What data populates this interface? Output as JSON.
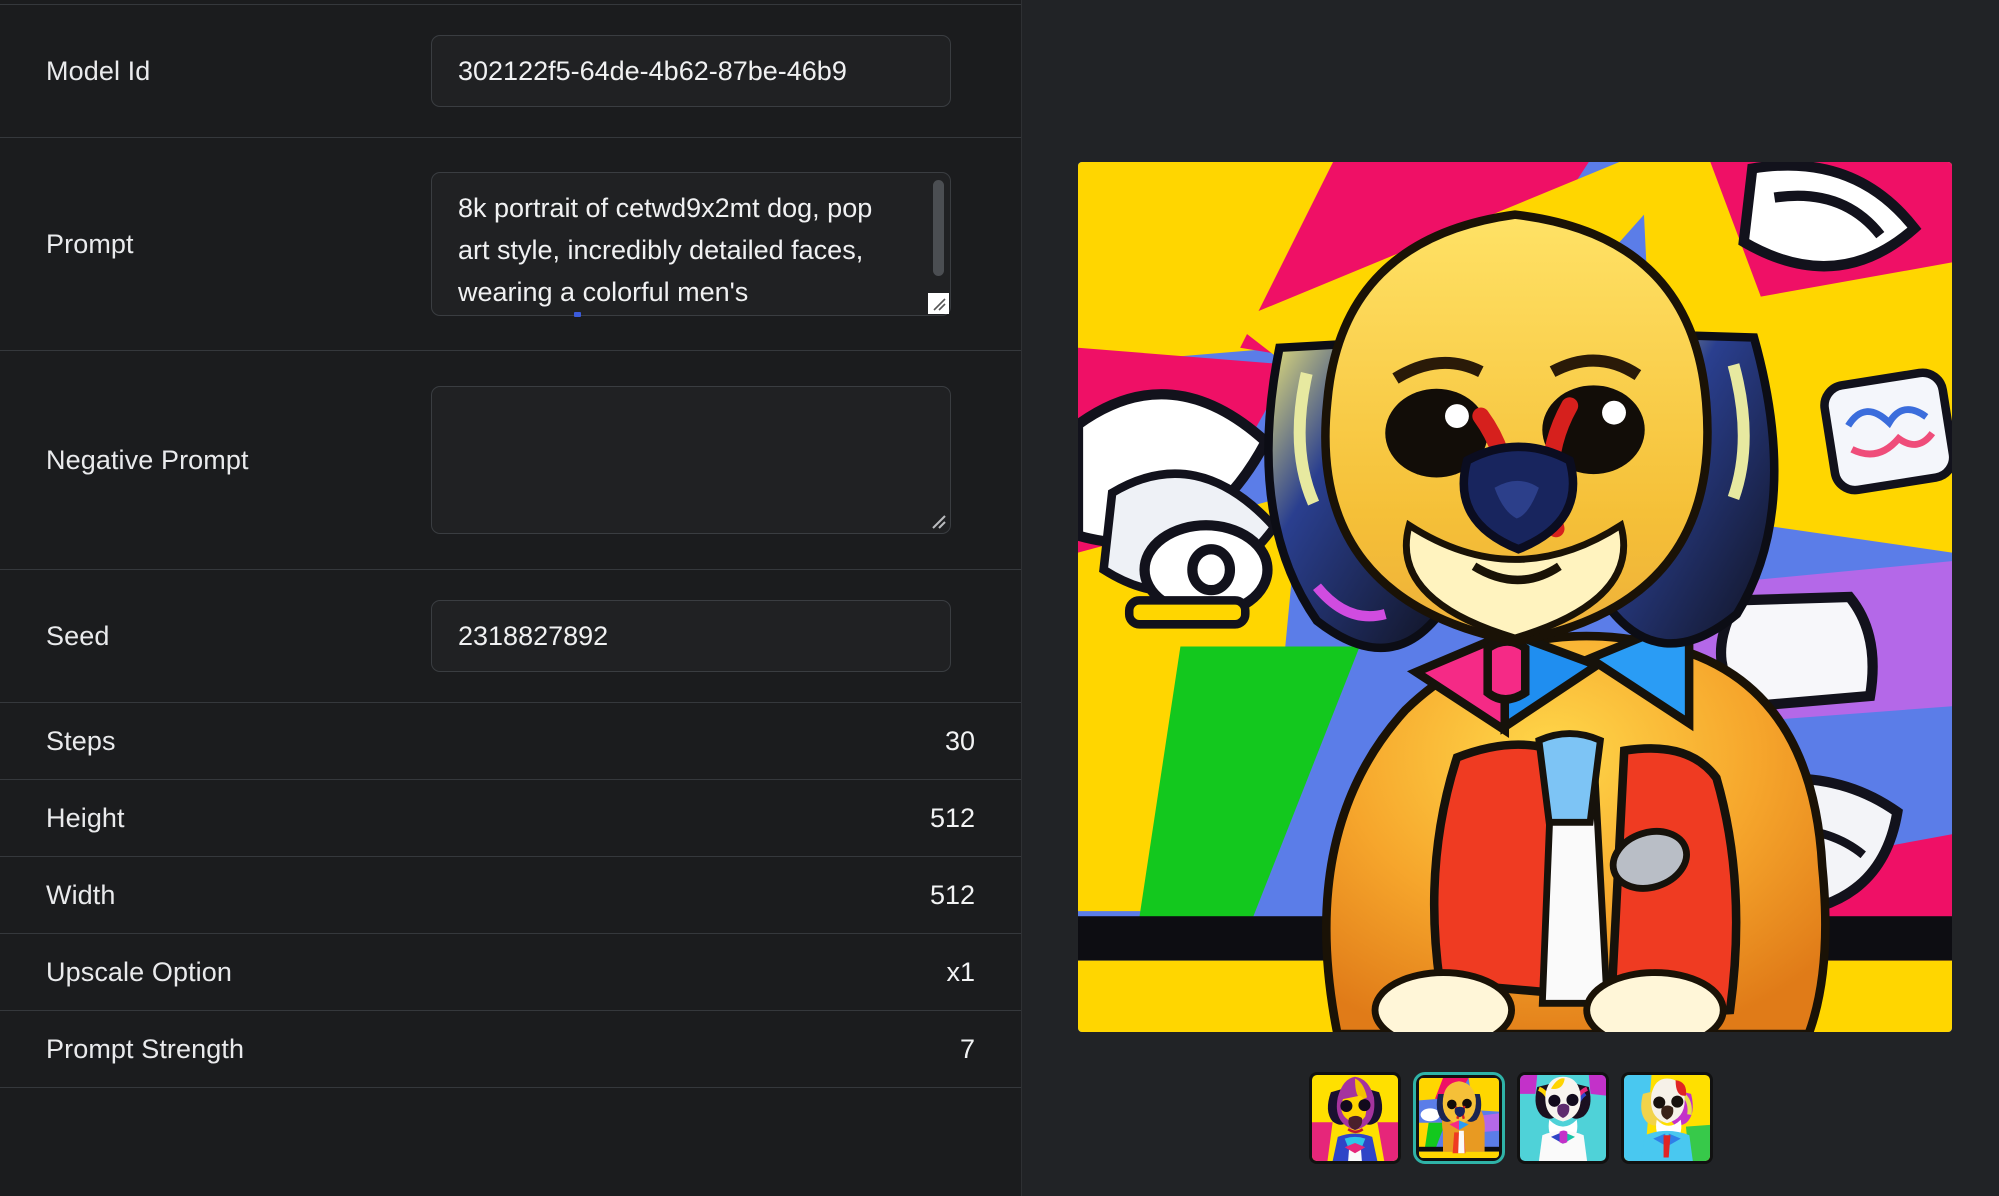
{
  "panel": {
    "fields": [
      {
        "label": "Model Id",
        "value": "302122f5-64de-4b62-87be-46b9",
        "type": "input"
      },
      {
        "label": "Prompt",
        "value": "8k portrait of cetwd9x2mt dog, pop art style, incredibly detailed faces, wearing a colorful men's",
        "type": "textarea"
      },
      {
        "label": "Negative Prompt",
        "value": "",
        "type": "textarea"
      },
      {
        "label": "Seed",
        "value": "2318827892",
        "type": "input"
      }
    ],
    "settings": [
      {
        "label": "Steps",
        "value": "30"
      },
      {
        "label": "Height",
        "value": "512"
      },
      {
        "label": "Width",
        "value": "512"
      },
      {
        "label": "Upscale Option",
        "value": "x1"
      },
      {
        "label": "Prompt Strength",
        "value": "7"
      }
    ]
  },
  "preview": {
    "hero_alt": "pop-art portrait of a pekingese dog wearing a colorful suit with pink and blue bow ties",
    "thumbnails": [
      {
        "alt": "pop-art dog on yellow background with blue suit and pink bow tie",
        "selected": false
      },
      {
        "alt": "pop-art dog in orange suit on multicolor comic background",
        "selected": true
      },
      {
        "alt": "pop-art dog with rainbow ears on teal background",
        "selected": false
      },
      {
        "alt": "pop-art dog on yellow and cyan background with red tie",
        "selected": false
      }
    ]
  },
  "colors": {
    "panel_background": "#1b1c1e",
    "preview_background": "#212326",
    "field_background": "#202123",
    "field_border": "#3a3d41",
    "divider": "#35383c",
    "text_primary": "#f2f3f4",
    "selection_accent": "#2fb3a8",
    "caret": "#3b5bdb"
  }
}
